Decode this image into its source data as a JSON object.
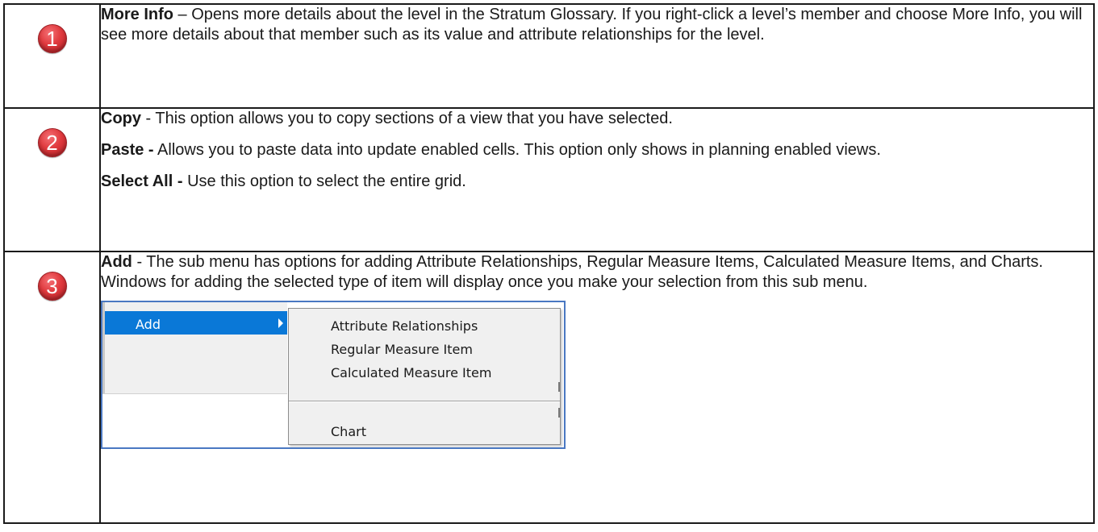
{
  "rows": [
    {
      "number": "1",
      "paragraphs": [
        {
          "bold": "More Info",
          "text": " – Opens more details about the level in the Stratum Glossary. If you right-click a level’s member and choose More Info, you will see more details about that member such as its value and attribute relationships for the level."
        }
      ]
    },
    {
      "number": "2",
      "paragraphs": [
        {
          "bold": "Copy",
          "text": " - This option allows you to copy sections of a view that you have selected."
        },
        {
          "bold": "Paste -",
          "text": " Allows you to paste data into update enabled cells. This option only shows in planning enabled views."
        },
        {
          "bold": "Select All -",
          "text": " Use this option to select the entire grid."
        }
      ]
    },
    {
      "number": "3",
      "paragraphs": [
        {
          "bold": "Add",
          "text": " - The sub menu has options for adding Attribute Relationships, Regular Measure Items, Calculated Measure Items, and Charts. Windows for adding the selected type of item will display once you make your selection from this sub menu."
        }
      ]
    }
  ],
  "menu": {
    "add_label": "Add",
    "submenu_items": [
      "Attribute Relationships",
      "Regular Measure Item",
      "Calculated Measure Item",
      "Chart"
    ]
  },
  "colors": {
    "badge_red": "#e03a3e",
    "menu_highlight": "#0a78d7",
    "screenshot_border": "#4a78c2"
  },
  "icons": {
    "badge": "numbered-circle-icon",
    "submenu_arrow": "triangle-right-icon"
  }
}
